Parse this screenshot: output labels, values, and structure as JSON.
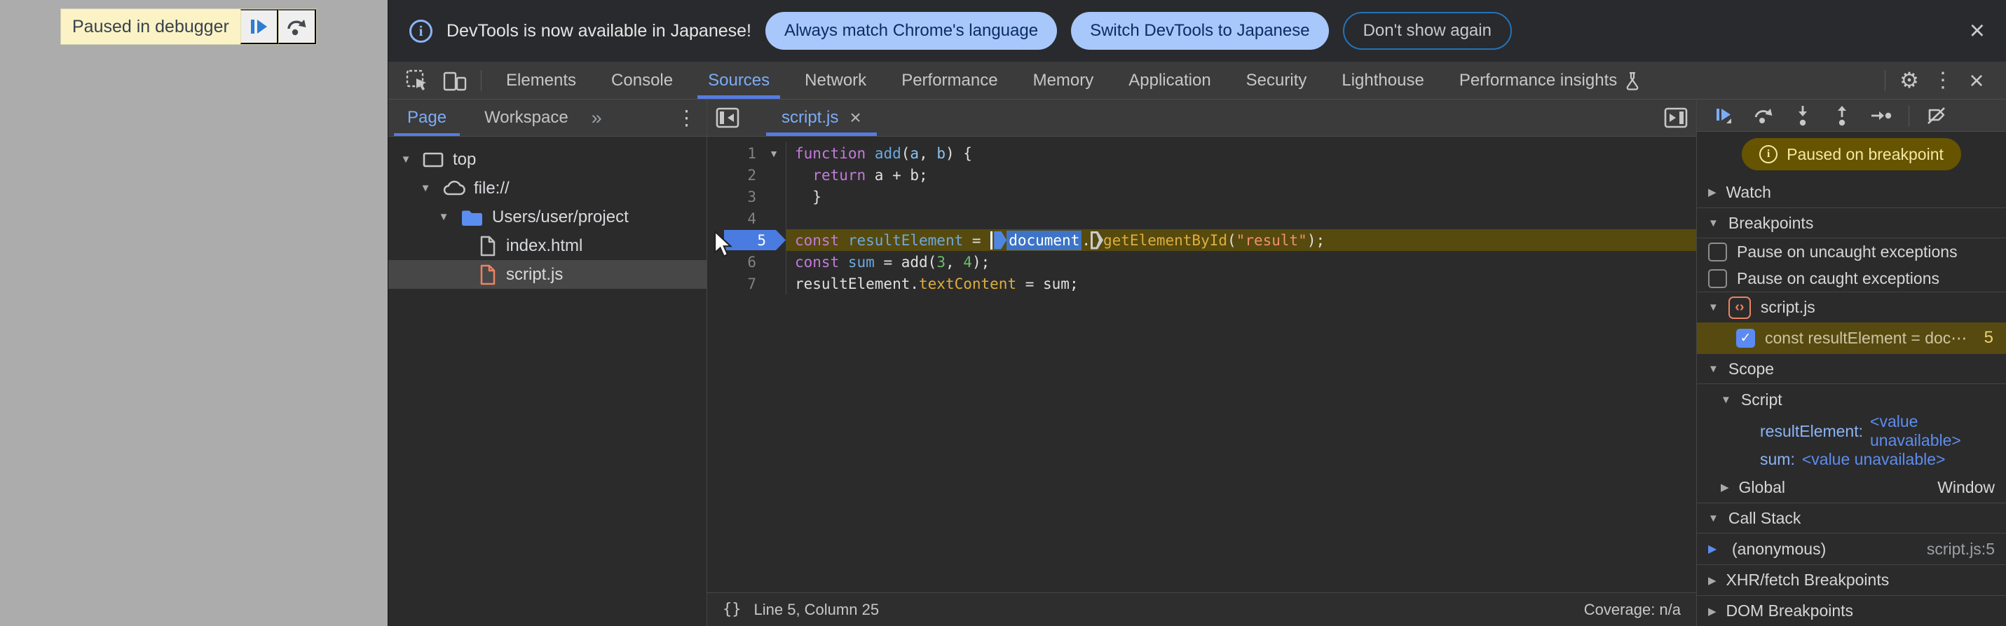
{
  "icons": {
    "close": "×",
    "more_vert": "⋮",
    "gear": "⚙",
    "chevrons": "»",
    "check": "✓",
    "collapsed": "▶",
    "expanded": "▼",
    "info": "i",
    "code": "‹›",
    "pretty_print": "{}"
  },
  "colors": {
    "accent_blue": "#7CACF8",
    "selection_blue": "#567BE4",
    "execution_line": "#564A0E",
    "paused_badge_bg": "#675400",
    "paused_badge_text": "#F2E9A2",
    "breakpoint_badge": "#4A7BE0",
    "file_js_orange": "#ED8262"
  },
  "page_overlay": {
    "label": "Paused in debugger"
  },
  "infobar": {
    "message": "DevTools is now available in Japanese!",
    "primary_button": "Always match Chrome's language",
    "secondary_button": "Switch DevTools to Japanese",
    "dismiss_button": "Don't show again"
  },
  "toolbar": {
    "tabs": [
      {
        "label": "Elements"
      },
      {
        "label": "Console"
      },
      {
        "label": "Sources",
        "selected": true
      },
      {
        "label": "Network"
      },
      {
        "label": "Performance"
      },
      {
        "label": "Memory"
      },
      {
        "label": "Application"
      },
      {
        "label": "Security"
      },
      {
        "label": "Lighthouse"
      },
      {
        "label": "Performance insights"
      }
    ]
  },
  "sidebar": {
    "tabs": [
      {
        "label": "Page",
        "selected": true
      },
      {
        "label": "Workspace"
      }
    ],
    "tree": [
      {
        "label": "top",
        "icon": "frame",
        "level": 0,
        "expanded": true
      },
      {
        "label": "file://",
        "icon": "cloud",
        "level": 1,
        "expanded": true
      },
      {
        "label": "Users/user/project",
        "icon": "folder",
        "level": 2,
        "expanded": true
      },
      {
        "label": "index.html",
        "icon": "file-html",
        "level": 3
      },
      {
        "label": "script.js",
        "icon": "file-js",
        "level": 3,
        "selected": true
      }
    ]
  },
  "editor": {
    "open_tab": {
      "label": "script.js"
    },
    "lines": [
      {
        "num": "1",
        "fold": true,
        "tokens": [
          [
            "k",
            "function"
          ],
          [
            "t",
            " "
          ],
          [
            "d",
            "add"
          ],
          [
            "t",
            "("
          ],
          [
            "p",
            "a"
          ],
          [
            "t",
            ", "
          ],
          [
            "p",
            "b"
          ],
          [
            "t",
            ") {"
          ]
        ]
      },
      {
        "num": "2",
        "tokens": [
          [
            "t",
            "  "
          ],
          [
            "k",
            "return"
          ],
          [
            "t",
            " a + b;"
          ]
        ]
      },
      {
        "num": "3",
        "tokens": [
          [
            "t",
            "  }"
          ]
        ]
      },
      {
        "num": "4",
        "tokens": []
      },
      {
        "num": "5",
        "exec": true,
        "badge": true,
        "tokens": [
          [
            "k",
            "const"
          ],
          [
            "t",
            " "
          ],
          [
            "d",
            "resultElement"
          ],
          [
            "t",
            " = "
          ],
          [
            "caret",
            ""
          ],
          [
            "mk1",
            ""
          ],
          [
            "sel",
            "document"
          ],
          [
            "t",
            "."
          ],
          [
            "mk2",
            ""
          ],
          [
            "pr",
            "getElementById"
          ],
          [
            "t",
            "("
          ],
          [
            "s",
            "\"result\""
          ],
          [
            "t",
            ");"
          ]
        ]
      },
      {
        "num": "6",
        "tokens": [
          [
            "k",
            "const"
          ],
          [
            "t",
            " "
          ],
          [
            "d",
            "sum"
          ],
          [
            "t",
            " = add("
          ],
          [
            "n",
            "3"
          ],
          [
            "t",
            ", "
          ],
          [
            "n",
            "4"
          ],
          [
            "t",
            ");"
          ]
        ]
      },
      {
        "num": "7",
        "tokens": [
          [
            "t",
            "resultElement."
          ],
          [
            "pr",
            "textContent"
          ],
          [
            "t",
            " = sum;"
          ]
        ]
      }
    ],
    "status": {
      "position": "Line 5, Column 25",
      "coverage": "Coverage: n/a"
    }
  },
  "debugger": {
    "paused_badge": "Paused on breakpoint",
    "watch": "Watch",
    "breakpoints": {
      "title": "Breakpoints",
      "pause_uncaught": "Pause on uncaught exceptions",
      "pause_caught": "Pause on caught exceptions",
      "file": "script.js",
      "entry": {
        "label": "const resultElement = doc⋯",
        "line": "5"
      }
    },
    "scope": {
      "title": "Scope",
      "script_section": "Script",
      "vars": [
        {
          "name": "resultElement:",
          "value": "<value unavailable>"
        },
        {
          "name": "sum:",
          "value": "<value unavailable>"
        }
      ],
      "global_label": "Global",
      "global_value": "Window"
    },
    "call_stack": {
      "title": "Call Stack",
      "frames": [
        {
          "name": "(anonymous)",
          "location": "script.js:5"
        }
      ]
    },
    "xhr": "XHR/fetch Breakpoints",
    "dom": "DOM Breakpoints"
  }
}
